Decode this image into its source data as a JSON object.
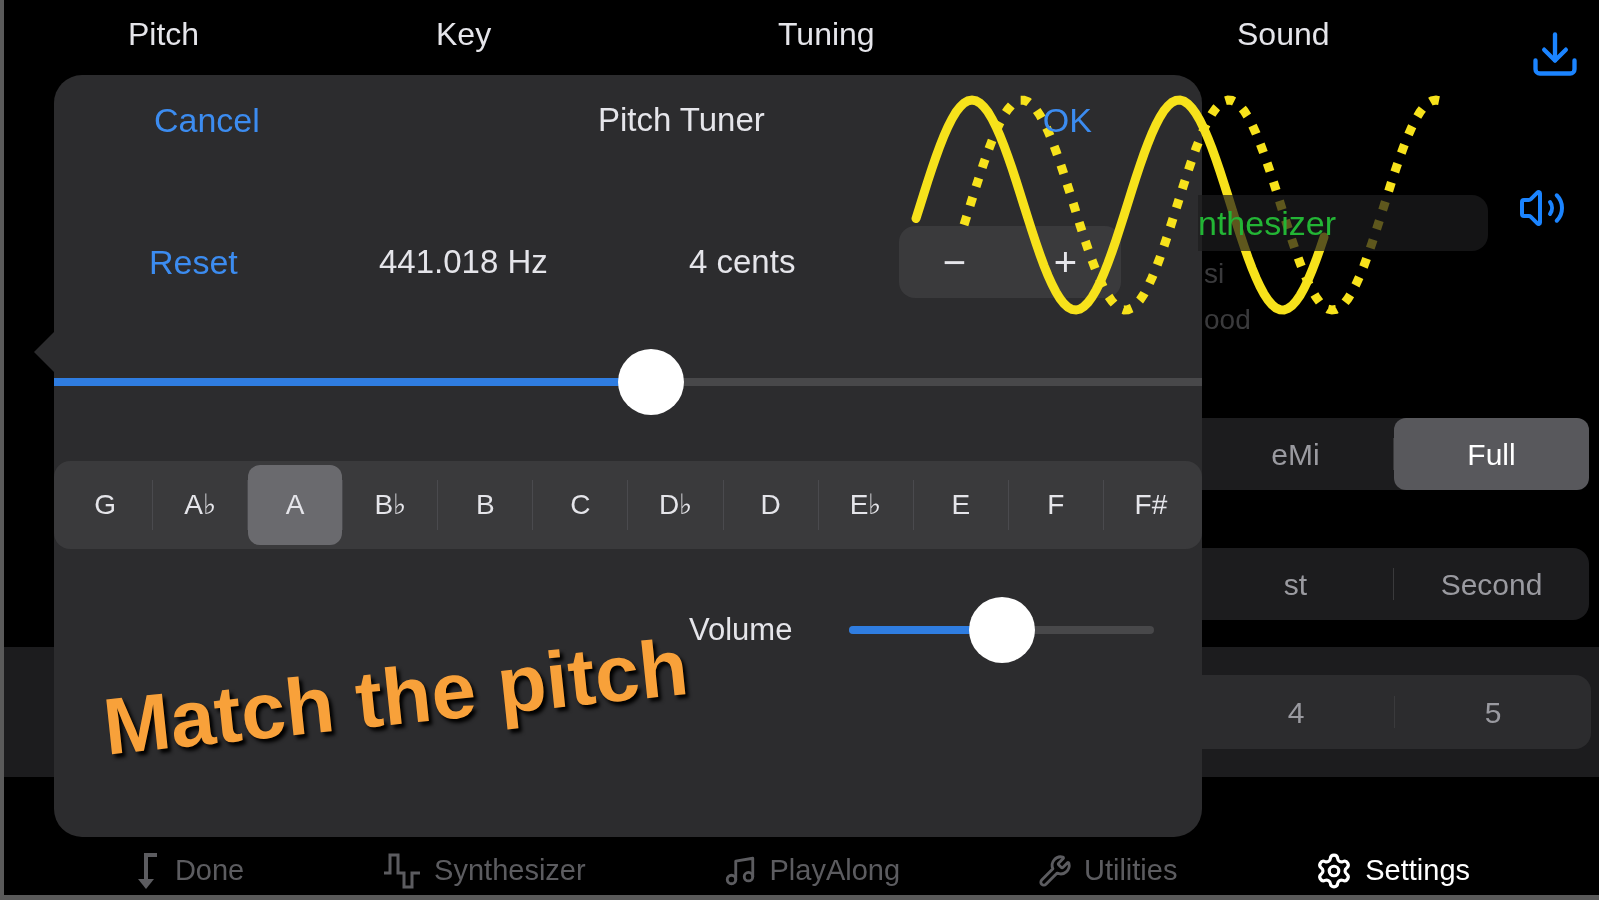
{
  "header_tabs": [
    {
      "label": "Pitch"
    },
    {
      "label": "Key"
    },
    {
      "label": "Tuning"
    },
    {
      "label": "Sound"
    }
  ],
  "background": {
    "instrument": "nthesizer",
    "faint_lines": [
      "si",
      "ood"
    ],
    "mode_segment": [
      {
        "label": "eMi",
        "selected": false
      },
      {
        "label": "Full",
        "selected": true
      }
    ],
    "string_segment": [
      {
        "label": "st",
        "selected": false
      },
      {
        "label": "Second",
        "selected": false
      }
    ],
    "number_segment": [
      {
        "label": "4",
        "selected": false
      },
      {
        "label": "5",
        "selected": false
      }
    ]
  },
  "popover": {
    "cancel": "Cancel",
    "title": "Pitch Tuner",
    "ok": "OK",
    "reset": "Reset",
    "frequency": "441.018 Hz",
    "cents": "4 cents",
    "stepper": {
      "minus": "−",
      "plus": "+"
    },
    "pitch_slider": {
      "level": 0.52
    },
    "notes": [
      {
        "label": "G",
        "selected": false
      },
      {
        "label": "A♭",
        "selected": false
      },
      {
        "label": "A",
        "selected": true
      },
      {
        "label": "B♭",
        "selected": false
      },
      {
        "label": "B",
        "selected": false
      },
      {
        "label": "C",
        "selected": false
      },
      {
        "label": "D♭",
        "selected": false
      },
      {
        "label": "D",
        "selected": false
      },
      {
        "label": "E♭",
        "selected": false
      },
      {
        "label": "E",
        "selected": false
      },
      {
        "label": "F",
        "selected": false
      },
      {
        "label": "F#",
        "selected": false
      }
    ],
    "volume": {
      "label": "Volume",
      "level": 0.5
    }
  },
  "annotation": "Match the pitch",
  "tab_bar": [
    {
      "label": "Done",
      "kind": "done",
      "selected": false
    },
    {
      "label": "Synthesizer",
      "kind": "synth",
      "selected": false
    },
    {
      "label": "PlayAlong",
      "kind": "note",
      "selected": false
    },
    {
      "label": "Utilities",
      "kind": "wrench",
      "selected": false
    },
    {
      "label": "Settings",
      "kind": "gear",
      "selected": true
    }
  ]
}
